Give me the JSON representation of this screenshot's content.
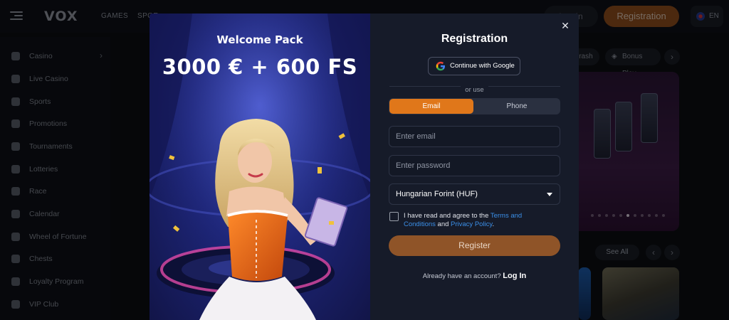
{
  "header": {
    "logo": "VOX",
    "nav": [
      "GAMES",
      "SPOR"
    ],
    "login_label": "Log In",
    "register_label": "Registration",
    "language": "EN"
  },
  "sidebar": {
    "items": [
      {
        "label": "Casino",
        "icon": "casino-icon",
        "expandable": true
      },
      {
        "label": "Live Casino",
        "icon": "live-casino-icon"
      },
      {
        "label": "Sports",
        "icon": "sports-icon"
      },
      {
        "label": "Promotions",
        "icon": "gift-icon"
      },
      {
        "label": "Tournaments",
        "icon": "trophy-icon"
      },
      {
        "label": "Lotteries",
        "icon": "lottery-icon"
      },
      {
        "label": "Race",
        "icon": "flag-icon"
      },
      {
        "label": "Calendar",
        "icon": "calendar-icon"
      },
      {
        "label": "Wheel of Fortune",
        "icon": "wheel-icon"
      },
      {
        "label": "Chests",
        "icon": "chest-icon"
      },
      {
        "label": "Loyalty Program",
        "icon": "loyalty-icon"
      },
      {
        "label": "VIP Club",
        "icon": "diamond-icon"
      }
    ]
  },
  "main": {
    "chips": [
      "Crash",
      "Bonus Play"
    ],
    "see_all_label": "See All"
  },
  "modal": {
    "promo": {
      "title": "Welcome Pack",
      "amount": "3000 € + 600 FS"
    },
    "form": {
      "title": "Registration",
      "google_label": "Continue with Google",
      "or_use": "or use",
      "tabs": [
        {
          "label": "Email",
          "active": true
        },
        {
          "label": "Phone",
          "active": false
        }
      ],
      "email_placeholder": "Enter email",
      "password_placeholder": "Enter password",
      "currency_value": "Hungarian Forint (HUF)",
      "agree_prefix": "I have read and agree to the ",
      "terms_label": "Terms and Conditions",
      "and_text": " and ",
      "privacy_label": "Privacy Policy",
      "period": ".",
      "register_label": "Register",
      "have_account_text": "Already have an account? ",
      "login_link_label": "Log In"
    }
  },
  "colors": {
    "accent_orange": "#e0771a",
    "register_button": "#8f5428",
    "link_blue": "#3b8fe8",
    "modal_bg": "#161b29"
  }
}
